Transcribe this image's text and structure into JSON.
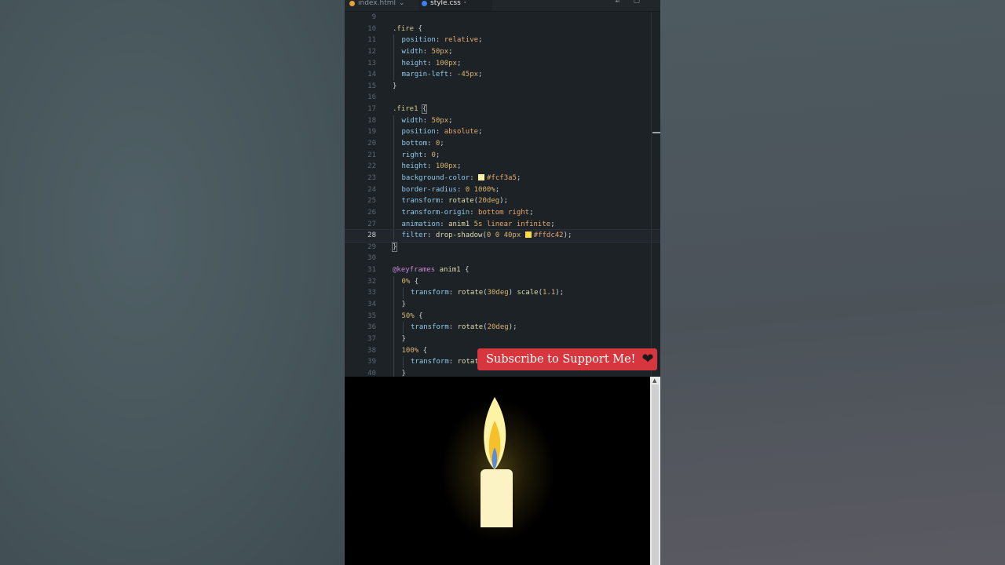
{
  "tabs": [
    {
      "label": "index.html",
      "dot_color": "#e8a33a",
      "active": false
    },
    {
      "label": "style.css",
      "dot_color": "#3b82f6",
      "active": true
    }
  ],
  "code": {
    "first_line": 9,
    "current_line": 28,
    "lines": [
      {
        "n": "9",
        "tokens": []
      },
      {
        "n": "10",
        "indent": 0,
        "tokens": [
          {
            "t": ".fire",
            "c": "sel"
          },
          {
            "t": " {",
            "c": "p"
          }
        ]
      },
      {
        "n": "11",
        "indent": 1,
        "tokens": [
          {
            "t": "position",
            "c": "prop"
          },
          {
            "t": ": ",
            "c": "p"
          },
          {
            "t": "relative",
            "c": "val"
          },
          {
            "t": ";",
            "c": "p"
          }
        ]
      },
      {
        "n": "12",
        "indent": 1,
        "tokens": [
          {
            "t": "width",
            "c": "prop"
          },
          {
            "t": ": ",
            "c": "p"
          },
          {
            "t": "50px",
            "c": "num"
          },
          {
            "t": ";",
            "c": "p"
          }
        ]
      },
      {
        "n": "13",
        "indent": 1,
        "tokens": [
          {
            "t": "height",
            "c": "prop"
          },
          {
            "t": ": ",
            "c": "p"
          },
          {
            "t": "100px",
            "c": "num"
          },
          {
            "t": ";",
            "c": "p"
          }
        ]
      },
      {
        "n": "14",
        "indent": 1,
        "tokens": [
          {
            "t": "margin-left",
            "c": "prop"
          },
          {
            "t": ": ",
            "c": "p"
          },
          {
            "t": "-45px",
            "c": "num"
          },
          {
            "t": ";",
            "c": "p"
          }
        ]
      },
      {
        "n": "15",
        "indent": 0,
        "tokens": [
          {
            "t": "}",
            "c": "p"
          }
        ]
      },
      {
        "n": "16",
        "indent": 0,
        "tokens": []
      },
      {
        "n": "17",
        "indent": 0,
        "tokens": [
          {
            "t": ".fire1",
            "c": "sel"
          },
          {
            "t": " ",
            "c": "p"
          },
          {
            "t": "{",
            "c": "br"
          }
        ]
      },
      {
        "n": "18",
        "indent": 1,
        "tokens": [
          {
            "t": "width",
            "c": "prop"
          },
          {
            "t": ": ",
            "c": "p"
          },
          {
            "t": "50px",
            "c": "num"
          },
          {
            "t": ";",
            "c": "p"
          }
        ]
      },
      {
        "n": "19",
        "indent": 1,
        "tokens": [
          {
            "t": "position",
            "c": "prop"
          },
          {
            "t": ": ",
            "c": "p"
          },
          {
            "t": "absolute",
            "c": "val"
          },
          {
            "t": ";",
            "c": "p"
          }
        ]
      },
      {
        "n": "20",
        "indent": 1,
        "tokens": [
          {
            "t": "bottom",
            "c": "prop"
          },
          {
            "t": ": ",
            "c": "p"
          },
          {
            "t": "0",
            "c": "num"
          },
          {
            "t": ";",
            "c": "p"
          }
        ]
      },
      {
        "n": "21",
        "indent": 1,
        "tokens": [
          {
            "t": "right",
            "c": "prop"
          },
          {
            "t": ": ",
            "c": "p"
          },
          {
            "t": "0",
            "c": "num"
          },
          {
            "t": ";",
            "c": "p"
          }
        ]
      },
      {
        "n": "22",
        "indent": 1,
        "tokens": [
          {
            "t": "height",
            "c": "prop"
          },
          {
            "t": ": ",
            "c": "p"
          },
          {
            "t": "100px",
            "c": "num"
          },
          {
            "t": ";",
            "c": "p"
          }
        ]
      },
      {
        "n": "23",
        "indent": 1,
        "tokens": [
          {
            "t": "background-color",
            "c": "prop"
          },
          {
            "t": ": ",
            "c": "p"
          },
          {
            "sw": "#fcf3a5"
          },
          {
            "t": "#fcf3a5",
            "c": "val"
          },
          {
            "t": ";",
            "c": "p"
          }
        ]
      },
      {
        "n": "24",
        "indent": 1,
        "tokens": [
          {
            "t": "border-radius",
            "c": "prop"
          },
          {
            "t": ": ",
            "c": "p"
          },
          {
            "t": "0 1000%",
            "c": "num"
          },
          {
            "t": ";",
            "c": "p"
          }
        ]
      },
      {
        "n": "25",
        "indent": 1,
        "tokens": [
          {
            "t": "transform",
            "c": "prop"
          },
          {
            "t": ": ",
            "c": "p"
          },
          {
            "t": "rotate",
            "c": "fn"
          },
          {
            "t": "(",
            "c": "p"
          },
          {
            "t": "20deg",
            "c": "num"
          },
          {
            "t": ");",
            "c": "p"
          }
        ]
      },
      {
        "n": "26",
        "indent": 1,
        "tokens": [
          {
            "t": "transform-origin",
            "c": "prop"
          },
          {
            "t": ": ",
            "c": "p"
          },
          {
            "t": "bottom right",
            "c": "val"
          },
          {
            "t": ";",
            "c": "p"
          }
        ]
      },
      {
        "n": "27",
        "indent": 1,
        "tokens": [
          {
            "t": "animation",
            "c": "prop"
          },
          {
            "t": ": ",
            "c": "p"
          },
          {
            "t": "anim1 ",
            "c": "fn"
          },
          {
            "t": "5s",
            "c": "num"
          },
          {
            "t": " linear infinite",
            "c": "val"
          },
          {
            "t": ";",
            "c": "p"
          }
        ]
      },
      {
        "n": "28",
        "indent": 1,
        "tokens": [
          {
            "t": "filter",
            "c": "prop"
          },
          {
            "t": ": ",
            "c": "p"
          },
          {
            "t": "drop-shadow",
            "c": "fn"
          },
          {
            "t": "(",
            "c": "p"
          },
          {
            "t": "0 0 40px ",
            "c": "num"
          },
          {
            "sw": "#ffdc42"
          },
          {
            "t": "#ffdc42",
            "c": "val"
          },
          {
            "t": ");",
            "c": "p"
          }
        ]
      },
      {
        "n": "29",
        "indent": 0,
        "tokens": [
          {
            "t": "}",
            "c": "br"
          }
        ]
      },
      {
        "n": "30",
        "indent": 0,
        "tokens": []
      },
      {
        "n": "31",
        "indent": 0,
        "tokens": [
          {
            "t": "@keyframes",
            "c": "at"
          },
          {
            "t": " anim1 ",
            "c": "fn"
          },
          {
            "t": "{",
            "c": "p"
          }
        ]
      },
      {
        "n": "32",
        "indent": 1,
        "tokens": [
          {
            "t": "0%",
            "c": "num"
          },
          {
            "t": " {",
            "c": "p"
          }
        ]
      },
      {
        "n": "33",
        "indent": 2,
        "tokens": [
          {
            "t": "transform",
            "c": "prop"
          },
          {
            "t": ": ",
            "c": "p"
          },
          {
            "t": "rotate",
            "c": "fn"
          },
          {
            "t": "(",
            "c": "p"
          },
          {
            "t": "30deg",
            "c": "num"
          },
          {
            "t": ") ",
            "c": "p"
          },
          {
            "t": "scale",
            "c": "fn"
          },
          {
            "t": "(",
            "c": "p"
          },
          {
            "t": "1.1",
            "c": "num"
          },
          {
            "t": ");",
            "c": "p"
          }
        ]
      },
      {
        "n": "34",
        "indent": 1,
        "tokens": [
          {
            "t": "}",
            "c": "p"
          }
        ]
      },
      {
        "n": "35",
        "indent": 1,
        "tokens": [
          {
            "t": "50%",
            "c": "num"
          },
          {
            "t": " {",
            "c": "p"
          }
        ]
      },
      {
        "n": "36",
        "indent": 2,
        "tokens": [
          {
            "t": "transform",
            "c": "prop"
          },
          {
            "t": ": ",
            "c": "p"
          },
          {
            "t": "rotate",
            "c": "fn"
          },
          {
            "t": "(",
            "c": "p"
          },
          {
            "t": "20deg",
            "c": "num"
          },
          {
            "t": ");",
            "c": "p"
          }
        ]
      },
      {
        "n": "37",
        "indent": 1,
        "tokens": [
          {
            "t": "}",
            "c": "p"
          }
        ]
      },
      {
        "n": "38",
        "indent": 1,
        "tokens": [
          {
            "t": "100%",
            "c": "num"
          },
          {
            "t": " {",
            "c": "p"
          }
        ]
      },
      {
        "n": "39",
        "indent": 2,
        "tokens": [
          {
            "t": "transform",
            "c": "prop"
          },
          {
            "t": ": ",
            "c": "p"
          },
          {
            "t": "rotate",
            "c": "fn"
          }
        ]
      },
      {
        "n": "40",
        "indent": 1,
        "tokens": [
          {
            "t": "}",
            "c": "p"
          }
        ]
      }
    ]
  },
  "subscribe": {
    "label": "Subscribe to Support Me!",
    "icon": "heart-icon",
    "color": "#d7363e"
  },
  "preview": {
    "candle_color": "#fcf3c5",
    "flame_color": "#fcf3a5",
    "glow_color": "#ffdc42",
    "core_color": "#f5c02a",
    "inner_color": "#5b8be0"
  }
}
